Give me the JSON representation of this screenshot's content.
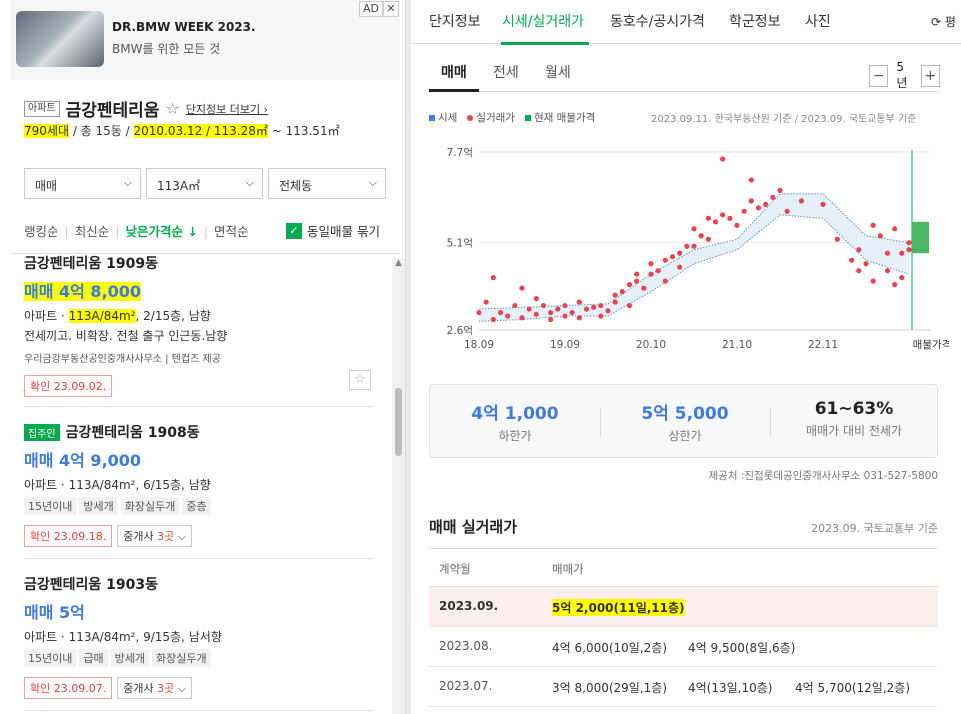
{
  "ad": {
    "title": "DR.BMW WEEK 2023.",
    "subtitle": "BMW를 위한 모든 것",
    "badge": "AD",
    "close": "✕"
  },
  "complex": {
    "type_tag": "아파트",
    "name": "금강펜테리움",
    "star": "☆",
    "more_link": "단지정보 더보기",
    "more_arrow": "›",
    "households": "790세대",
    "info_mid": " / 총 15동 / ",
    "date": "2010.03.12",
    "info_sep": " / ",
    "area_min": "113.28㎡",
    "area_rest": " ~ 113.51㎡"
  },
  "filters": [
    {
      "label": "매매"
    },
    {
      "label": "113A㎡"
    },
    {
      "label": "전체동"
    }
  ],
  "sort": {
    "items": [
      "랭킹순",
      "최신순",
      "낮은가격순 ↓",
      "면적순"
    ],
    "check_label": "동일매물 묶기"
  },
  "listings": [
    {
      "title": "금강펜테리움 1909동",
      "price": "매매 4억 8,000",
      "detail_prefix": "아파트 · ",
      "detail_area": "113A/84m²",
      "detail_suffix": ", 2/15층, 남향",
      "desc": "전세끼고. 비확장. 전철 출구 인근동.남향",
      "agency": "우리금강부동산공인중개사사무소 | 텐컵즈 제공",
      "confirm": "확인 23.09.02."
    },
    {
      "badge": "집주인",
      "title": "금강펜테리움 1908동",
      "price": "매매 4억 9,000",
      "detail": "아파트 · 113A/84m², 6/15층, 남향",
      "tags": [
        "15년이내",
        "방세개",
        "화장실두개",
        "중층"
      ],
      "confirm": "확인 23.09.18.",
      "broker": "중개사",
      "broker_count": "3곳"
    },
    {
      "title": "금강펜테리움 1903동",
      "price": "매매 5억",
      "detail": "아파트 · 113A/84m², 9/15층, 남서향",
      "tags": [
        "15년이내",
        "급매",
        "방세개",
        "화장실두개"
      ],
      "confirm": "확인 23.09.07.",
      "broker": "중개사",
      "broker_count": "3곳"
    }
  ],
  "tabs": {
    "items": [
      "단지정보",
      "시세/실거래가",
      "동호수/공시가격",
      "학군정보",
      "사진"
    ],
    "refresh": "⟳ 평"
  },
  "subtabs": {
    "items": [
      "매매",
      "전세",
      "월세"
    ],
    "period": "5년",
    "minus": "−",
    "plus": "+"
  },
  "legend": {
    "items": [
      "시세",
      "실거래가",
      "현재 매물가격"
    ],
    "colors": [
      "#3e7bdf",
      "#e8434f",
      "#03a94e"
    ]
  },
  "source_note": "2023.09.11. 한국부동산원 기준 / 2023.09. 국토교통부 기준",
  "chart_data": {
    "type": "scatter",
    "title": "",
    "xlabel": "",
    "ylabel": "",
    "x_ticks": [
      "18.09",
      "19.09",
      "20.10",
      "21.10",
      "22.11",
      "매물가격"
    ],
    "y_ticks": [
      "7.7억",
      "5.1억",
      "2.6억"
    ],
    "ylim": [
      2.6,
      7.7
    ],
    "series": [
      {
        "name": "시세",
        "type": "band",
        "x": [
          0,
          6,
          12,
          18,
          24,
          30,
          36,
          42,
          48,
          54,
          60
        ],
        "low": [
          2.85,
          2.9,
          3.0,
          3.0,
          3.7,
          4.5,
          4.9,
          5.9,
          5.8,
          4.6,
          4.2
        ],
        "high": [
          3.2,
          3.25,
          3.3,
          3.35,
          4.2,
          4.9,
          5.2,
          6.5,
          6.5,
          5.3,
          5.1
        ]
      },
      {
        "name": "실거래가",
        "type": "scatter",
        "points": [
          [
            0,
            3.1
          ],
          [
            1,
            3.4
          ],
          [
            2,
            2.9
          ],
          [
            2,
            4.1
          ],
          [
            3,
            3.1
          ],
          [
            4,
            3.0
          ],
          [
            5,
            3.3
          ],
          [
            6,
            2.95
          ],
          [
            6,
            3.8
          ],
          [
            7,
            3.2
          ],
          [
            8,
            3.05
          ],
          [
            8,
            3.5
          ],
          [
            9,
            3.3
          ],
          [
            10,
            2.9
          ],
          [
            10,
            3.1
          ],
          [
            11,
            3.2
          ],
          [
            12,
            3.0
          ],
          [
            12,
            3.3
          ],
          [
            13,
            3.1
          ],
          [
            14,
            2.95
          ],
          [
            14,
            3.4
          ],
          [
            15,
            3.2
          ],
          [
            16,
            3.25
          ],
          [
            17,
            3.0
          ],
          [
            17,
            3.3
          ],
          [
            18,
            3.15
          ],
          [
            19,
            3.4
          ],
          [
            19,
            3.6
          ],
          [
            20,
            3.7
          ],
          [
            21,
            3.3
          ],
          [
            21,
            3.9
          ],
          [
            22,
            4.0
          ],
          [
            22,
            4.2
          ],
          [
            23,
            3.8
          ],
          [
            24,
            4.2
          ],
          [
            24,
            4.5
          ],
          [
            25,
            4.3
          ],
          [
            26,
            4.0
          ],
          [
            26,
            4.6
          ],
          [
            27,
            4.7
          ],
          [
            28,
            4.8
          ],
          [
            28,
            4.4
          ],
          [
            29,
            5.0
          ],
          [
            30,
            5.0
          ],
          [
            30,
            5.5
          ],
          [
            31,
            5.3
          ],
          [
            32,
            5.2
          ],
          [
            32,
            5.8
          ],
          [
            33,
            5.7
          ],
          [
            34,
            5.9
          ],
          [
            34,
            7.5
          ],
          [
            35,
            5.8
          ],
          [
            36,
            5.6
          ],
          [
            37,
            6.0
          ],
          [
            38,
            6.3
          ],
          [
            38,
            6.9
          ],
          [
            39,
            6.1
          ],
          [
            40,
            6.2
          ],
          [
            41,
            6.4
          ],
          [
            42,
            6.6
          ],
          [
            43,
            6.0
          ],
          [
            45,
            6.3
          ],
          [
            48,
            6.2
          ],
          [
            50,
            5.2
          ],
          [
            52,
            4.6
          ],
          [
            53,
            4.9
          ],
          [
            53,
            4.3
          ],
          [
            54,
            4.5
          ],
          [
            55,
            5.6
          ],
          [
            55,
            4.0
          ],
          [
            56,
            5.3
          ],
          [
            57,
            4.8
          ],
          [
            57,
            4.3
          ],
          [
            58,
            5.5
          ],
          [
            58,
            3.9
          ],
          [
            59,
            4.8
          ],
          [
            59,
            4.1
          ],
          [
            60,
            4.9
          ],
          [
            60,
            5.1
          ]
        ]
      },
      {
        "name": "현재 매물가격",
        "type": "range",
        "low": 4.8,
        "high": 5.7
      }
    ]
  },
  "stats": [
    {
      "value": "4억 1,000",
      "label": "하한가"
    },
    {
      "value": "5억 5,000",
      "label": "상한가"
    },
    {
      "value": "61~63%",
      "label": "매매가 대비 전세가"
    }
  ],
  "provider": "제공처 :진접롯데공인중개사사무소 031-527-5800",
  "deals": {
    "heading": "매매 실거래가",
    "source": "2023.09. 국토교통부 기준",
    "col_month": "계약월",
    "col_price": "매매가",
    "rows": [
      {
        "month": "2023.09.",
        "prices": [
          "5억 2,000(11일,11층)"
        ]
      },
      {
        "month": "2023.08.",
        "prices": [
          "4억 6,000(10일,2층)",
          "4억 9,500(8일,6층)"
        ]
      },
      {
        "month": "2023.07.",
        "prices": [
          "3억 8,000(29일,1층)",
          "4억(13일,10층)",
          "4억 5,700(12일,2층)"
        ]
      }
    ]
  }
}
